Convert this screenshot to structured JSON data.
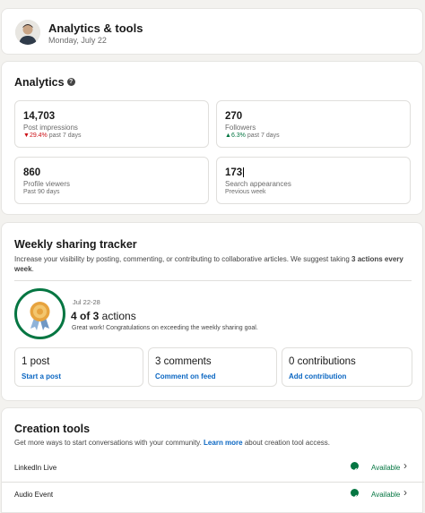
{
  "header": {
    "title": "Analytics & tools",
    "date": "Monday, July 22"
  },
  "analytics": {
    "title": "Analytics",
    "stats": [
      {
        "value": "14,703",
        "label": "Post impressions",
        "change": "29.4%",
        "change_dir": "down",
        "period": "past 7 days"
      },
      {
        "value": "270",
        "label": "Followers",
        "change": "6.3%",
        "change_dir": "up",
        "period": "past 7 days"
      },
      {
        "value": "860",
        "label": "Profile viewers",
        "period": "Past 90 days"
      },
      {
        "value": "173",
        "label": "Search appearances",
        "period": "Previous week"
      }
    ]
  },
  "tracker": {
    "title": "Weekly sharing tracker",
    "desc_pre": "Increase your visibility by posting, commenting, or contributing to collaborative articles. We suggest taking ",
    "desc_bold": "3 actions every week",
    "desc_post": ".",
    "date_range": "Jul 22-28",
    "actions_count": "4 of 3",
    "actions_label": " actions",
    "message": "Great work! Congratulations on exceeding the weekly sharing goal.",
    "items": [
      {
        "count": "1 post",
        "link": "Start a post"
      },
      {
        "count": "3 comments",
        "link": "Comment on feed"
      },
      {
        "count": "0 contributions",
        "link": "Add contribution"
      }
    ]
  },
  "tools": {
    "title": "Creation tools",
    "desc_pre": "Get more ways to start conversations with your community. ",
    "learn_more": "Learn more",
    "desc_post": " about creation tool access.",
    "rows": [
      {
        "name": "LinkedIn Live",
        "status": "Available"
      },
      {
        "name": "Audio Event",
        "status": "Available"
      }
    ]
  },
  "colors": {
    "accent": "#0a66c2",
    "positive": "#057642",
    "negative": "#cc1016",
    "badge_gold": "#e7a33e"
  }
}
